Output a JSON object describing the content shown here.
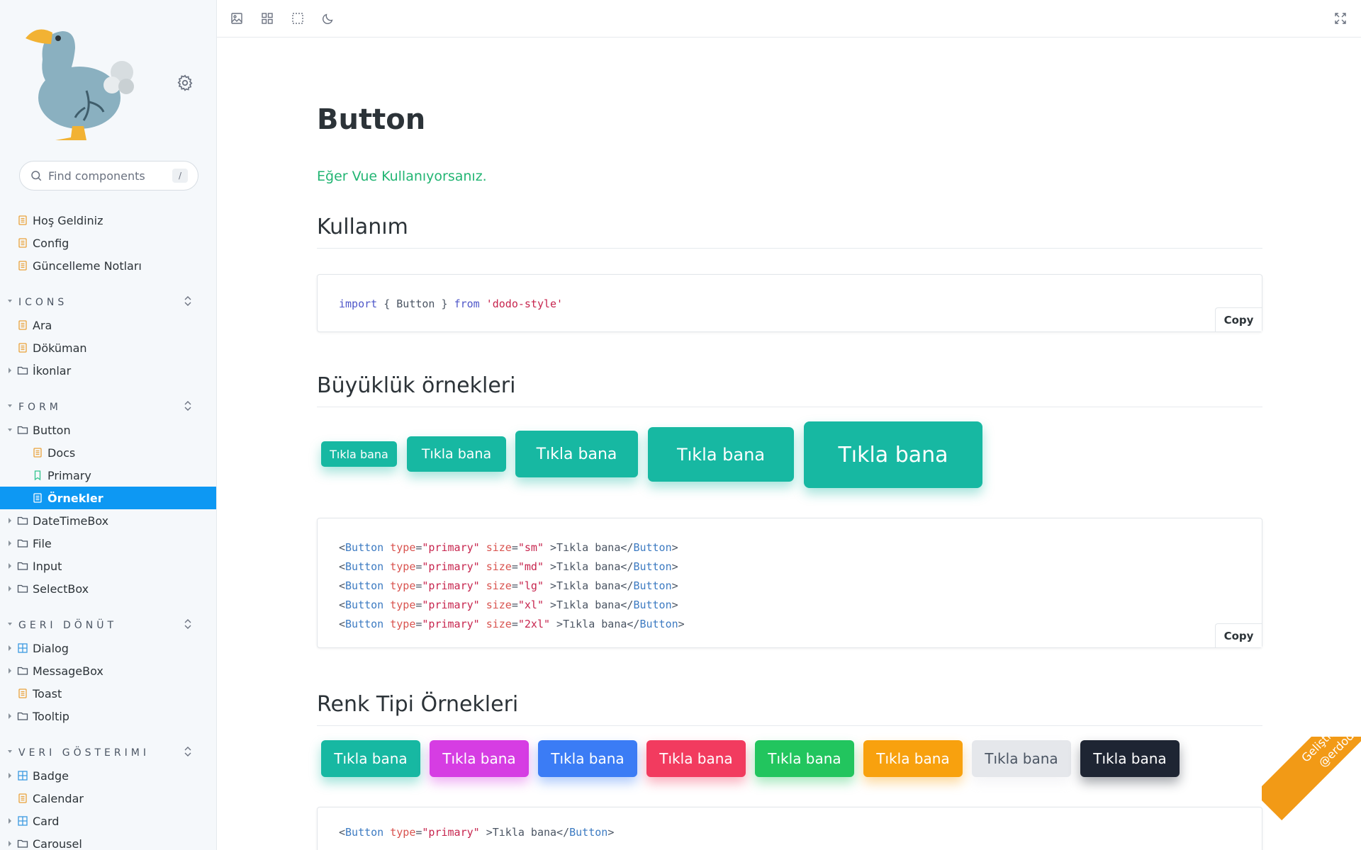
{
  "sidebar": {
    "search": {
      "placeholder": "Find components",
      "shortcut": "/"
    },
    "top_items": [
      {
        "label": "Hoş Geldiniz",
        "icon": "doc-icon"
      },
      {
        "label": "Config",
        "icon": "doc-icon"
      },
      {
        "label": "Güncelleme Notları",
        "icon": "doc-icon"
      }
    ],
    "sections": [
      {
        "title": "ICONS",
        "items": [
          {
            "label": "Ara",
            "icon": "doc-icon"
          },
          {
            "label": "Döküman",
            "icon": "doc-icon"
          },
          {
            "label": "İkonlar",
            "icon": "folder-icon"
          }
        ]
      },
      {
        "title": "FORM",
        "items": [
          {
            "label": "Button",
            "icon": "folder-icon",
            "expanded": true
          },
          {
            "label": "Docs",
            "icon": "doc-icon"
          },
          {
            "label": "Primary",
            "icon": "bookmark-icon"
          },
          {
            "label": "Örnekler",
            "icon": "doc-icon",
            "active": true
          },
          {
            "label": "DateTimeBox",
            "icon": "folder-icon"
          },
          {
            "label": "File",
            "icon": "folder-icon"
          },
          {
            "label": "Input",
            "icon": "folder-icon"
          },
          {
            "label": "SelectBox",
            "icon": "folder-icon"
          }
        ]
      },
      {
        "title": "GERI DÖNÜT",
        "items": [
          {
            "label": "Dialog",
            "icon": "component-icon"
          },
          {
            "label": "MessageBox",
            "icon": "folder-icon"
          },
          {
            "label": "Toast",
            "icon": "doc-icon"
          },
          {
            "label": "Tooltip",
            "icon": "folder-icon"
          }
        ]
      },
      {
        "title": "VERI GÖSTERIMI",
        "items": [
          {
            "label": "Badge",
            "icon": "component-icon"
          },
          {
            "label": "Calendar",
            "icon": "doc-icon"
          },
          {
            "label": "Card",
            "icon": "component-icon"
          },
          {
            "label": "Carousel",
            "icon": "folder-icon"
          }
        ]
      }
    ]
  },
  "toolbar": {
    "icons": [
      "image-icon",
      "grid-icon",
      "select-area-icon",
      "moon-icon"
    ],
    "fullscreen_icon": "fullscreen-icon"
  },
  "page": {
    "title": "Button",
    "vue_link": "Eğer Vue Kullanıyorsanız.",
    "usage_heading": "Kullanım",
    "usage_code": {
      "kw1": "import",
      "mid": " { Button } ",
      "kw2": "from",
      "str": "'dodo-style'"
    },
    "copy_label": "Copy",
    "size_heading": "Büyüklük örnekleri",
    "button_label": "Tıkla bana",
    "size_buttons": [
      "sm",
      "md",
      "lg",
      "xl",
      "2xl"
    ],
    "size_code_lines": [
      {
        "size": "\"sm\"",
        "text": " >Tıkla bana</"
      },
      {
        "size": "\"md\"",
        "text": " >Tıkla bana</"
      },
      {
        "size": "\"lg\"",
        "text": " >Tıkla bana</"
      },
      {
        "size": "\"xl\"",
        "text": " >Tıkla bana</"
      },
      {
        "size": "\"2xl\"",
        "text": " >Tıkla bana</"
      }
    ],
    "code_tag": "Button",
    "code_attr_type": "type",
    "code_attr_size": "size",
    "code_type_val": "\"primary\"",
    "color_heading": "Renk Tipi Örnekleri",
    "color_buttons": [
      {
        "color": "#17b8a2",
        "text_color": "#ffffff"
      },
      {
        "color": "#d63de3",
        "text_color": "#ffffff"
      },
      {
        "color": "#3b7cf5",
        "text_color": "#ffffff"
      },
      {
        "color": "#f23b5f",
        "text_color": "#ffffff"
      },
      {
        "color": "#22c55e",
        "text_color": "#ffffff"
      },
      {
        "color": "#f8a10e",
        "text_color": "#ffffff"
      },
      {
        "color": "#e5e7eb",
        "text_color": "#4b5563"
      },
      {
        "color": "#1e2533",
        "text_color": "#ffffff"
      }
    ],
    "color_code_line": {
      "text": " >Tıkla bana</"
    }
  },
  "ribbon": {
    "line1": "Geliştiriliyor",
    "line2": "@erdodo"
  },
  "colors": {
    "accent": "#0d98f3",
    "teal": "#17b8a2",
    "link": "#22b573"
  }
}
